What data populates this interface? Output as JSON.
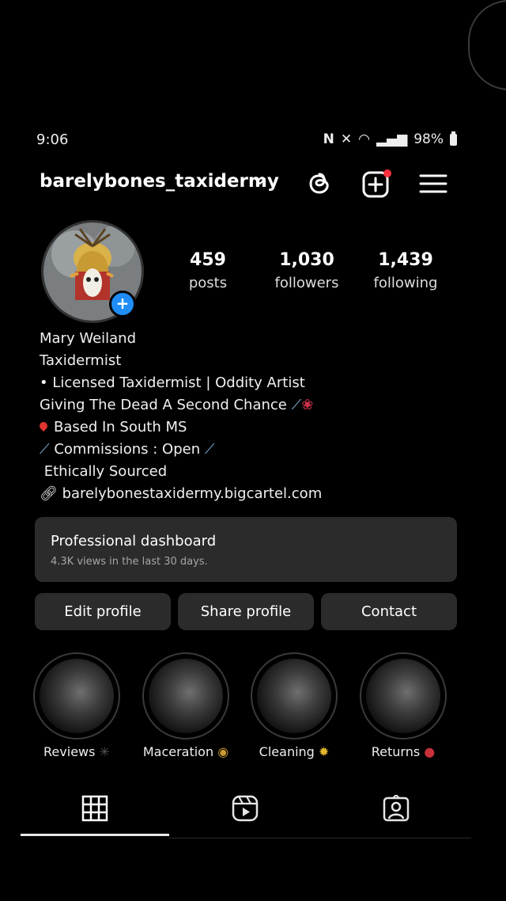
{
  "status_bar": {
    "time": "9:06",
    "battery": "98%"
  },
  "header": {
    "username": "barelybones_taxidermy"
  },
  "profile": {
    "stats": [
      {
        "value": "459",
        "label": "posts"
      },
      {
        "value": "1,030",
        "label": "followers"
      },
      {
        "value": "1,439",
        "label": "following"
      }
    ],
    "bio": {
      "name": "Mary Weiland",
      "category": "Taxidermist",
      "line1": "• Licensed Taxidermist | Oddity Artist",
      "line2": "Giving The Dead A Second Chance",
      "line3": "Based In South MS",
      "line4": "Commissions : Open",
      "line5": "Ethically Sourced",
      "link": "barelybonestaxidermy.bigcartel.com"
    }
  },
  "dashboard": {
    "title": "Professional dashboard",
    "subtitle": "4.3K views in the last 30 days."
  },
  "buttons": {
    "edit": "Edit profile",
    "share": "Share profile",
    "contact": "Contact"
  },
  "highlights": [
    {
      "label": "Reviews"
    },
    {
      "label": "Maceration"
    },
    {
      "label": "Cleaning"
    },
    {
      "label": "Returns"
    }
  ],
  "tabs": [
    {
      "icon": "grid-icon",
      "active": true
    },
    {
      "icon": "reels-icon",
      "active": false
    },
    {
      "icon": "tagged-icon",
      "active": false
    }
  ],
  "colors": {
    "background": "#000000",
    "card": "#2b2b2b",
    "accent": "#1f8df5",
    "notification": "#ff3040"
  }
}
